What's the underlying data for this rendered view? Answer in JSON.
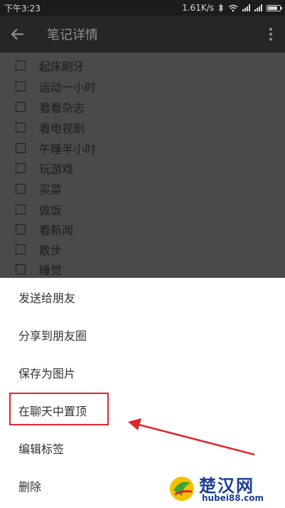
{
  "status_bar": {
    "time": "下午3:23",
    "speed": "1.61K/s"
  },
  "app_bar": {
    "title": "笔记详情"
  },
  "checklist": {
    "items": [
      {
        "label": "起床刷牙",
        "checked": false
      },
      {
        "label": "运动一小时",
        "checked": false
      },
      {
        "label": "看看杂志",
        "checked": false
      },
      {
        "label": "看电视剧",
        "checked": false
      },
      {
        "label": "午睡半小时",
        "checked": false
      },
      {
        "label": "玩游戏",
        "checked": false
      },
      {
        "label": "买菜",
        "checked": false
      },
      {
        "label": "做饭",
        "checked": false
      },
      {
        "label": "看新闻",
        "checked": false
      },
      {
        "label": "散步",
        "checked": false
      },
      {
        "label": "睡觉",
        "checked": false
      }
    ]
  },
  "sheet": {
    "items": [
      {
        "label": "发送给朋友"
      },
      {
        "label": "分享到朋友圈"
      },
      {
        "label": "保存为图片"
      },
      {
        "label": "在聊天中置顶"
      },
      {
        "label": "编辑标签"
      },
      {
        "label": "删除"
      }
    ]
  },
  "annotation": {
    "color": "#e0262b"
  },
  "watermark": {
    "name": "楚汉网",
    "url": "hubei88.com"
  }
}
